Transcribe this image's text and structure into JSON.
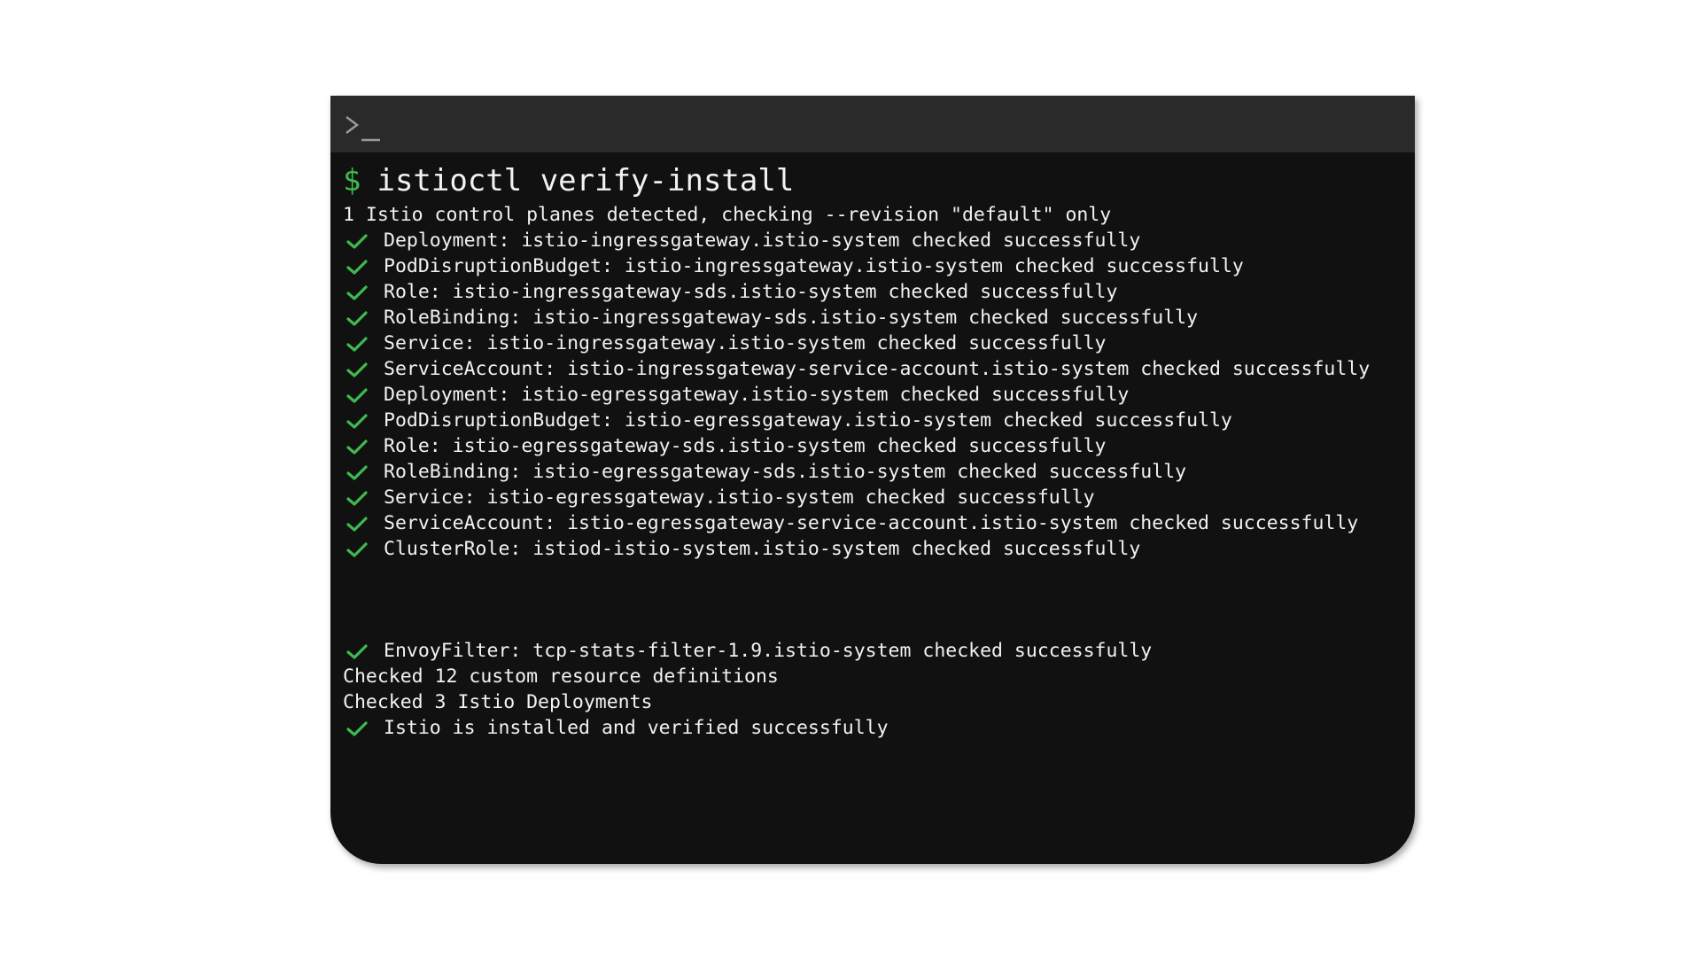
{
  "window": {
    "prompt_icon": "terminal-prompt-icon",
    "accent_color": "#3fb950"
  },
  "command": {
    "prompt_symbol": "$",
    "text": "istioctl verify-install"
  },
  "output": {
    "header": "1 Istio control planes detected, checking --revision \"default\" only",
    "checks_block1": [
      "Deployment: istio-ingressgateway.istio-system checked successfully",
      "PodDisruptionBudget: istio-ingressgateway.istio-system checked successfully",
      "Role: istio-ingressgateway-sds.istio-system checked successfully",
      "RoleBinding: istio-ingressgateway-sds.istio-system checked successfully",
      "Service: istio-ingressgateway.istio-system checked successfully",
      "ServiceAccount: istio-ingressgateway-service-account.istio-system checked successfully",
      "Deployment: istio-egressgateway.istio-system checked successfully",
      "PodDisruptionBudget: istio-egressgateway.istio-system checked successfully",
      "Role: istio-egressgateway-sds.istio-system checked successfully",
      "RoleBinding: istio-egressgateway-sds.istio-system checked successfully",
      "Service: istio-egressgateway.istio-system checked successfully",
      "ServiceAccount: istio-egressgateway-service-account.istio-system checked successfully",
      "ClusterRole: istiod-istio-system.istio-system checked successfully"
    ],
    "check_envoyfilter": "EnvoyFilter: tcp-stats-filter-1.9.istio-system checked successfully",
    "summary_crd": "Checked 12 custom resource definitions",
    "summary_deployments": "Checked 3 Istio Deployments",
    "final_check": "Istio is installed and verified successfully"
  }
}
